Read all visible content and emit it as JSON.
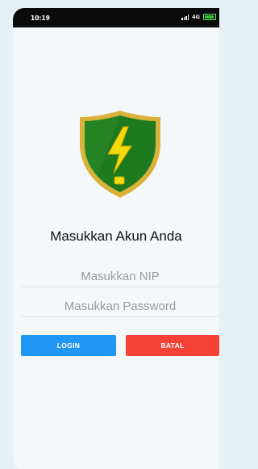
{
  "status_bar": {
    "time": "10:19",
    "network": "4G"
  },
  "login": {
    "title": "Masukkan Akun Anda",
    "nip_placeholder": "Masukkan NIP",
    "password_placeholder": "Masukkan Password",
    "login_label": "LOGIN",
    "cancel_label": "BATAL"
  },
  "logo": {
    "icon": "shield-lightning-icon"
  },
  "colors": {
    "login_button": "#2196f3",
    "cancel_button": "#f44336",
    "shield_green": "#1e7a1e",
    "shield_gold": "#d9b23a",
    "bolt_yellow": "#f5d90a"
  }
}
